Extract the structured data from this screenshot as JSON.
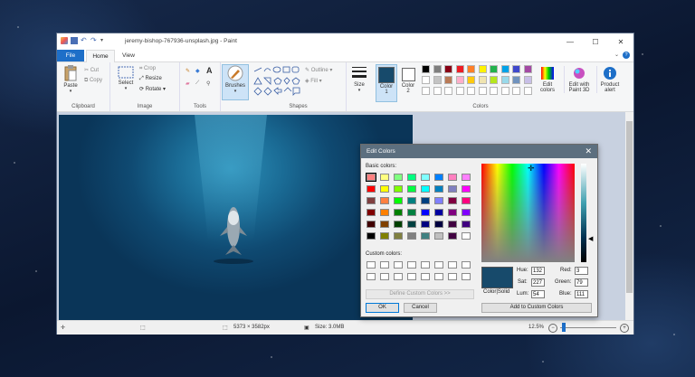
{
  "window": {
    "title": "jeremy-bishop-767936-unsplash.jpg - Paint"
  },
  "tabs": {
    "file": "File",
    "home": "Home",
    "view": "View"
  },
  "ribbon": {
    "clipboard": {
      "paste": "Paste",
      "cut": "Cut",
      "copy": "Copy",
      "group": "Clipboard"
    },
    "image": {
      "select": "Select",
      "crop": "Crop",
      "resize": "Resize",
      "rotate": "Rotate",
      "group": "Image"
    },
    "tools": {
      "group": "Tools"
    },
    "brushes": {
      "label": "Brushes"
    },
    "shapes": {
      "outline": "Outline",
      "fill": "Fill",
      "group": "Shapes"
    },
    "size": {
      "label": "Size"
    },
    "color1": {
      "label": "Color",
      "num": "1"
    },
    "color2": {
      "label": "Color",
      "num": "2"
    },
    "colors_group": "Colors",
    "edit_colors": {
      "line1": "Edit",
      "line2": "colors"
    },
    "edit_paint3d": {
      "line1": "Edit with",
      "line2": "Paint 3D"
    },
    "product_alert": {
      "line1": "Product",
      "line2": "alert"
    }
  },
  "palette": {
    "row1": [
      "#000000",
      "#7f7f7f",
      "#880015",
      "#ed1c24",
      "#ff7f27",
      "#fff200",
      "#22b14c",
      "#00a2e8",
      "#3f48cc",
      "#a349a4"
    ],
    "row2": [
      "#ffffff",
      "#c3c3c3",
      "#b97a57",
      "#ffaec9",
      "#ffc90e",
      "#efe4b0",
      "#b5e61d",
      "#99d9ea",
      "#7092be",
      "#c8bfe7"
    ],
    "row3": [
      "#ffffff",
      "#ffffff",
      "#ffffff",
      "#ffffff",
      "#ffffff",
      "#ffffff",
      "#ffffff",
      "#ffffff",
      "#ffffff",
      "#ffffff"
    ]
  },
  "colors": {
    "color1": "#174a6b",
    "color2": "#ffffff"
  },
  "status": {
    "dimensions": "5373 × 3582px",
    "size": "Size: 3.0MB",
    "zoom": "12.5%"
  },
  "dialog": {
    "title": "Edit Colors",
    "basic_label": "Basic colors:",
    "custom_label": "Custom colors:",
    "basic_colors": [
      [
        "#ff8080",
        "#ffff80",
        "#80ff80",
        "#00ff80",
        "#80ffff",
        "#0080ff",
        "#ff80c0",
        "#ff80ff"
      ],
      [
        "#ff0000",
        "#ffff00",
        "#80ff00",
        "#00ff40",
        "#00ffff",
        "#0080c0",
        "#8080c0",
        "#ff00ff"
      ],
      [
        "#804040",
        "#ff8040",
        "#00ff00",
        "#008080",
        "#004080",
        "#8080ff",
        "#800040",
        "#ff0080"
      ],
      [
        "#800000",
        "#ff8000",
        "#008000",
        "#008040",
        "#0000ff",
        "#0000a0",
        "#800080",
        "#8000ff"
      ],
      [
        "#400000",
        "#804000",
        "#004000",
        "#004040",
        "#000080",
        "#000040",
        "#400040",
        "#400080"
      ],
      [
        "#000000",
        "#808000",
        "#808040",
        "#808080",
        "#408080",
        "#c0c0c0",
        "#400040",
        "#ffffff"
      ]
    ],
    "define_custom": "Define Custom Colors >>",
    "ok": "OK",
    "cancel": "Cancel",
    "add_custom": "Add to Custom Colors",
    "color_solid": "Color|Solid",
    "preview": "#174a6b",
    "hue_label": "Hue:",
    "hue": "132",
    "sat_label": "Sat:",
    "sat": "227",
    "lum_label": "Lum:",
    "lum": "54",
    "red_label": "Red:",
    "red": "3",
    "green_label": "Green:",
    "green": "79",
    "blue_label": "Blue:",
    "blue": "111"
  }
}
